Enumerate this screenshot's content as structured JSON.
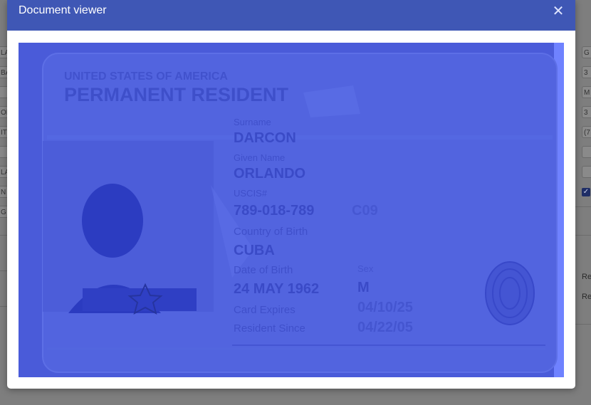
{
  "background": {
    "left_inputs": [
      "LA",
      "BA",
      "",
      "OR",
      "IT",
      "",
      "LA",
      "N",
      "G"
    ],
    "right_inputs": [
      "G",
      "3",
      "M",
      "3",
      "(7",
      "",
      ""
    ],
    "right_labels": [
      "Re",
      "Re"
    ]
  },
  "modal": {
    "title": "Document viewer",
    "close_icon": "close-icon"
  },
  "card": {
    "header_top": "UNITED STATES OF AMERICA",
    "header_main": "PERMANENT RESIDENT",
    "surname_label": "Surname",
    "surname": "DARCON",
    "given_label": "Given Name",
    "given_name": "ORLANDO",
    "uscis_label": "USCIS#",
    "uscis_number": "789-018-789",
    "category": "C09",
    "country_label": "Country of Birth",
    "country": "CUBA",
    "dob_label": "Date of Birth",
    "sex_label": "Sex",
    "dob": "24 MAY 1962",
    "sex": "M",
    "expires_label": "Card Expires",
    "expires": "04/10/25",
    "resident_label": "Resident Since",
    "resident_since": "04/22/05"
  },
  "colors": {
    "header": "#3f57b5",
    "doc_tint": "#4a5bd9"
  }
}
